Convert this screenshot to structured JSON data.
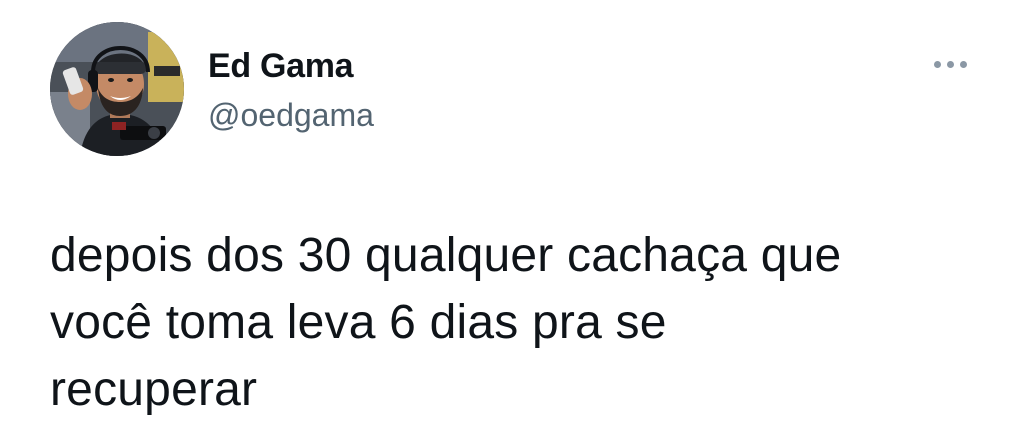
{
  "tweet": {
    "author": {
      "display_name": "Ed Gama",
      "handle": "@oedgama",
      "avatar_icon": "profile-photo-avatar"
    },
    "more_menu_icon": "ellipsis-horizontal-icon",
    "text": "depois dos 30 qualquer cachaça que\nvocê toma leva 6 dias pra se\nrecuperar"
  },
  "colors": {
    "text_primary": "#0f1419",
    "text_secondary": "#536471",
    "background": "#ffffff",
    "icon_muted": "#8b98a5"
  }
}
